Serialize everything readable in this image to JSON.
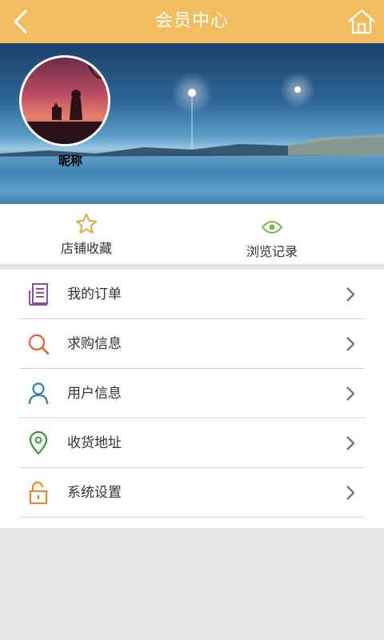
{
  "header": {
    "title": "会员中心",
    "back_icon": "back-arrow-icon",
    "home_icon": "home-icon",
    "background": "#f1bd5e"
  },
  "profile": {
    "nickname": "昵称"
  },
  "quick_links": [
    {
      "label": "店铺收藏",
      "icon": "star-icon",
      "color": "#e8a63c"
    },
    {
      "label": "浏览记录",
      "icon": "eye-icon",
      "color": "#7ab648"
    }
  ],
  "menu": [
    {
      "label": "我的订单",
      "icon": "order-list-icon",
      "color": "#8b4f9e"
    },
    {
      "label": "求购信息",
      "icon": "search-icon",
      "color": "#e35f37"
    },
    {
      "label": "用户信息",
      "icon": "user-icon",
      "color": "#2f7dbf"
    },
    {
      "label": "收货地址",
      "icon": "location-pin-icon",
      "color": "#3e9b3c"
    },
    {
      "label": "系统设置",
      "icon": "unlock-icon",
      "color": "#e9892e"
    }
  ]
}
